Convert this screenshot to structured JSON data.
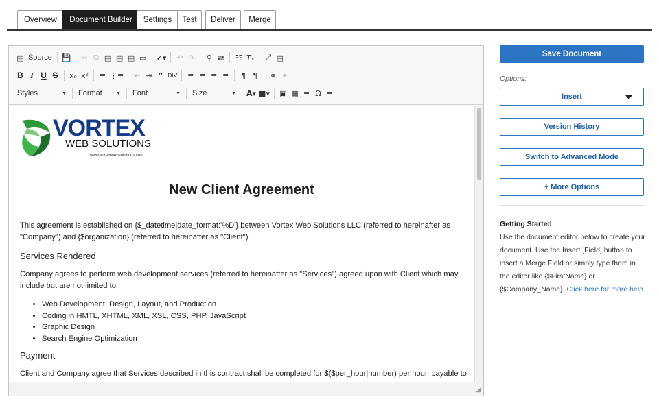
{
  "tabs": [
    {
      "label": "Overview",
      "active": false
    },
    {
      "label": "Document Builder",
      "active": true
    },
    {
      "label": "Settings",
      "active": false
    },
    {
      "label": "Test",
      "active": false
    },
    {
      "label": "Deliver",
      "active": false
    },
    {
      "label": "Merge",
      "active": false
    }
  ],
  "toolbar": {
    "source_label": "Source",
    "styles_label": "Styles",
    "format_label": "Format",
    "font_label": "Font",
    "size_label": "Size",
    "bold": "B",
    "italic": "I",
    "underline": "U",
    "strike": "S"
  },
  "document": {
    "logo_text_main": "VORTEX",
    "logo_text_sub": "WEB SOLUTIONS",
    "logo_url": "www.vortexwebsolutions.com",
    "title": "New Client Agreement",
    "intro": "This agreement is established on {$_datetime|date_format:'%D'} between Vortex Web Solutions LLC (referred to hereinafter as \"Company\") and {$organization} (referred to hereinafter as \"Client\") .",
    "services_heading": "Services Rendered",
    "services_text": "Company agrees to perform web development services (referred to hereinafter as \"Services\") agreed upon with Client which may include but are not limited to:",
    "services_list": [
      "Web Development, Design, Layout, and Production",
      "Coding in HMTL, XHTML, XML, XSL, CSS, PHP, JavaScript",
      "Graphic Design",
      "Search Engine Optimization"
    ],
    "payment_heading": "Payment",
    "payment_text": "Client and Company agree that Services described in this contract shall be completed for $($per_hour|number) per hour, payable to"
  },
  "side": {
    "save_label": "Save Document",
    "options_label": "Options:",
    "insert_label": "Insert",
    "version_label": "Version History",
    "advanced_label": "Switch to Advanced Mode",
    "more_label": "+ More Options",
    "gs_title": "Getting Started",
    "gs_text": "Use the document editor below to create your document. Use the Insert [Field] button to insert a Merge Field or simply type them in the editor like {$FirstName} or {$Company_Name}. ",
    "gs_link": "Click here for more help."
  },
  "colors": {
    "primary": "#2c74c4",
    "active_tab": "#1e1e1e",
    "logo_green": "#2e9a3a"
  },
  "icons": [
    "source-icon",
    "save-icon",
    "cut-icon",
    "copy-icon",
    "paste-icon",
    "paste-text-icon",
    "paste-word-icon",
    "template-icon",
    "spellcheck-icon",
    "undo-icon",
    "redo-icon",
    "find-icon",
    "replace-icon",
    "select-all-icon",
    "remove-format-icon",
    "maximize-icon",
    "show-blocks-icon",
    "numbered-list-icon",
    "bulleted-list-icon",
    "outdent-icon",
    "indent-icon",
    "blockquote-icon",
    "div-icon",
    "align-left-icon",
    "align-center-icon",
    "align-right-icon",
    "justify-icon",
    "ltr-icon",
    "rtl-icon",
    "link-icon",
    "unlink-icon",
    "text-color-icon",
    "bg-color-icon",
    "image-icon",
    "table-icon",
    "horizontal-line-icon",
    "special-char-icon",
    "page-break-icon"
  ]
}
